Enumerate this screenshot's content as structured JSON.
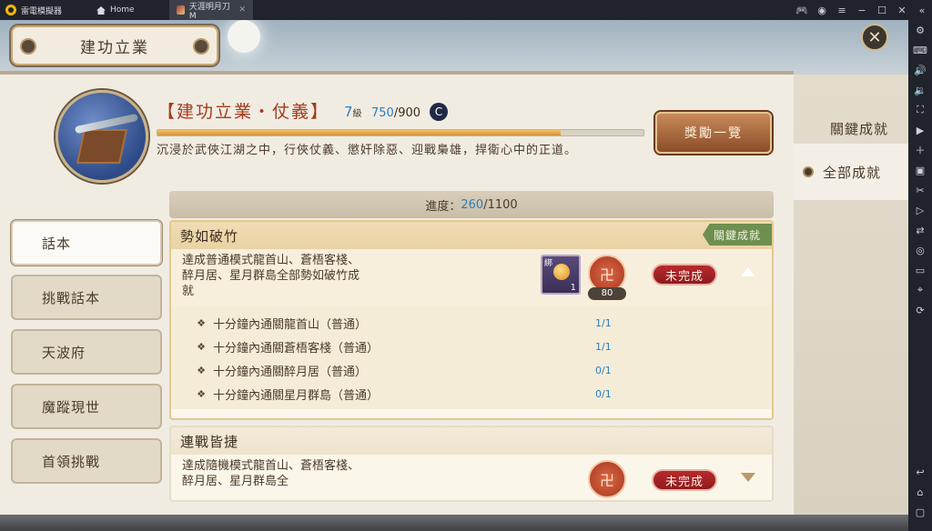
{
  "emulator": {
    "app_name": "雷電模擬器",
    "tabs": [
      {
        "label": "Home"
      },
      {
        "label": "天涯明月刀 M"
      }
    ]
  },
  "header": {
    "title": "建功立業",
    "close_glyph": "✕"
  },
  "achievement": {
    "title": "【建功立業・仗義】",
    "level": "7",
    "level_unit": "級",
    "points_current": "750",
    "points_max": "/900",
    "progress": 0.83,
    "description": "沉浸於武俠江湖之中，行俠仗義、懲奸除惡、迎戰梟雄，捍衛心中的正道。",
    "reward_button": "獎勵一覽"
  },
  "sidebar": {
    "items": [
      {
        "label": "話本",
        "active": true
      },
      {
        "label": "挑戰話本",
        "active": false
      },
      {
        "label": "天波府",
        "active": false
      },
      {
        "label": "魔蹤現世",
        "active": false
      },
      {
        "label": "首領挑戰",
        "active": false
      }
    ]
  },
  "right_nav": {
    "items": [
      {
        "label": "關鍵成就",
        "active": false
      },
      {
        "label": "全部成就",
        "active": true
      }
    ]
  },
  "progress": {
    "label": "進度：",
    "current": "260",
    "total": "/1100"
  },
  "cards": [
    {
      "title": "勢如破竹",
      "flag": "關鍵成就",
      "description": "達成普通模式龍首山、蒼梧客棧、醉月居、星月群島全部勢如破竹成就",
      "item_tag": "綁",
      "item_count": "1",
      "seal_glyph": "卍",
      "seal_count": "80",
      "status": "未完成",
      "sub_items": [
        {
          "text": "十分鐘內通關龍首山（普通）",
          "progress": "1/1"
        },
        {
          "text": "十分鐘內通關蒼梧客棧（普通）",
          "progress": "1/1"
        },
        {
          "text": "十分鐘內通關醉月居（普通）",
          "progress": "0/1"
        },
        {
          "text": "十分鐘內通關星月群島（普通）",
          "progress": "0/1"
        }
      ]
    },
    {
      "title": "連戰皆捷",
      "description": "達成隨機模式龍首山、蒼梧客棧、醉月居、星月群島全",
      "seal_glyph": "卍",
      "status": "未完成"
    }
  ],
  "colors": {
    "accent_red": "#a33b1e",
    "value_blue": "#2a7fbf",
    "status_red": "#b8292c",
    "flag_green": "#6e8f4f"
  }
}
